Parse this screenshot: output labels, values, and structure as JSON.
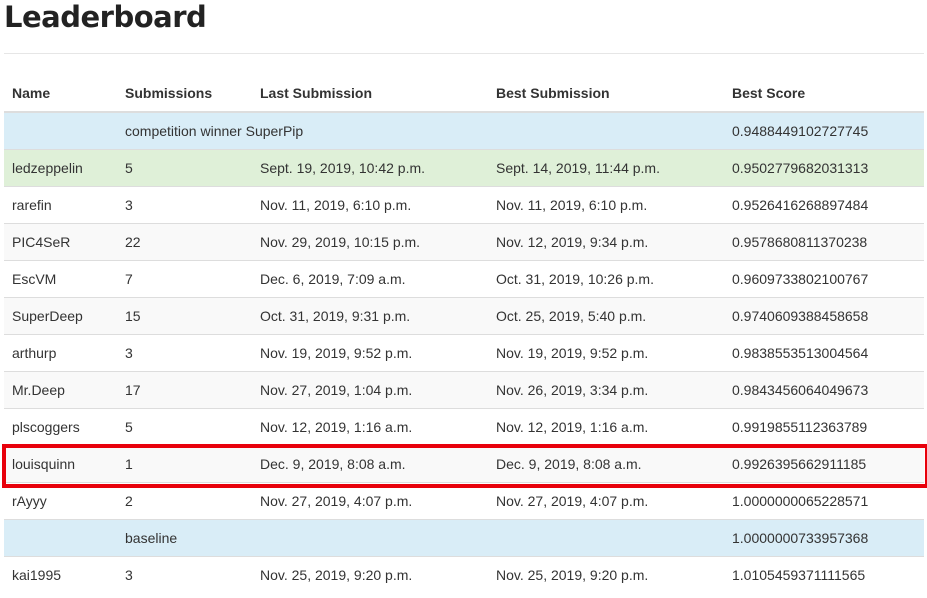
{
  "page": {
    "title": "Leaderboard"
  },
  "table": {
    "headers": [
      "Name",
      "Submissions",
      "Last Submission",
      "Best Submission",
      "Best Score"
    ],
    "rows": [
      {
        "style": "info",
        "name": "",
        "submissions": "competition winner SuperPip",
        "last": "",
        "best": "",
        "score": "0.9488449102727745"
      },
      {
        "style": "success",
        "name": "ledzeppelin",
        "submissions": "5",
        "last": "Sept. 19, 2019, 10:42 p.m.",
        "best": "Sept. 14, 2019, 11:44 p.m.",
        "score": "0.9502779682031313"
      },
      {
        "style": "even",
        "name": "rarefin",
        "submissions": "3",
        "last": "Nov. 11, 2019, 6:10 p.m.",
        "best": "Nov. 11, 2019, 6:10 p.m.",
        "score": "0.9526416268897484"
      },
      {
        "style": "odd",
        "name": "PIC4SeR",
        "submissions": "22",
        "last": "Nov. 29, 2019, 10:15 p.m.",
        "best": "Nov. 12, 2019, 9:34 p.m.",
        "score": "0.9578680811370238"
      },
      {
        "style": "even",
        "name": "EscVM",
        "submissions": "7",
        "last": "Dec. 6, 2019, 7:09 a.m.",
        "best": "Oct. 31, 2019, 10:26 p.m.",
        "score": "0.9609733802100767"
      },
      {
        "style": "odd",
        "name": "SuperDeep",
        "submissions": "15",
        "last": "Oct. 31, 2019, 9:31 p.m.",
        "best": "Oct. 25, 2019, 5:40 p.m.",
        "score": "0.9740609388458658"
      },
      {
        "style": "even",
        "name": "arthurp",
        "submissions": "3",
        "last": "Nov. 19, 2019, 9:52 p.m.",
        "best": "Nov. 19, 2019, 9:52 p.m.",
        "score": "0.9838553513004564"
      },
      {
        "style": "odd",
        "name": "Mr.Deep",
        "submissions": "17",
        "last": "Nov. 27, 2019, 1:04 p.m.",
        "best": "Nov. 26, 2019, 3:34 p.m.",
        "score": "0.9843456064049673"
      },
      {
        "style": "even",
        "name": "plscoggers",
        "submissions": "5",
        "last": "Nov. 12, 2019, 1:16 a.m.",
        "best": "Nov. 12, 2019, 1:16 a.m.",
        "score": "0.9919855112363789"
      },
      {
        "style": "odd",
        "name": "louisquinn",
        "submissions": "1",
        "last": "Dec. 9, 2019, 8:08 a.m.",
        "best": "Dec. 9, 2019, 8:08 a.m.",
        "score": "0.9926395662911185",
        "highlighted": true
      },
      {
        "style": "even",
        "name": "rAyyy",
        "submissions": "2",
        "last": "Nov. 27, 2019, 4:07 p.m.",
        "best": "Nov. 27, 2019, 4:07 p.m.",
        "score": "1.0000000065228571"
      },
      {
        "style": "info",
        "name": "",
        "submissions": "baseline",
        "last": "",
        "best": "",
        "score": "1.0000000733957368"
      },
      {
        "style": "even",
        "name": "kai1995",
        "submissions": "3",
        "last": "Nov. 25, 2019, 9:20 p.m.",
        "best": "Nov. 25, 2019, 9:20 p.m.",
        "score": "1.0105459371111565"
      }
    ]
  },
  "colors": {
    "info_row": "#d9edf7",
    "success_row": "#dff0d8",
    "striped_row": "#f9f9f9",
    "highlight_border": "#e8000b"
  }
}
